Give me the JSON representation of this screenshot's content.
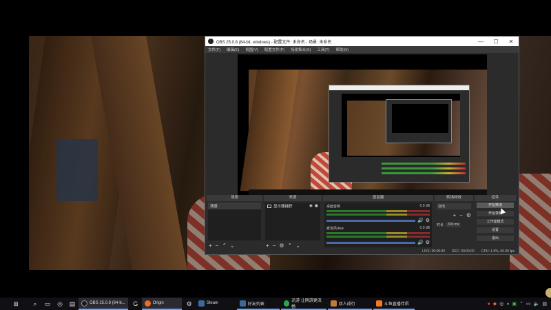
{
  "obs": {
    "title": "OBS 25.0.8 (64-bit, windows) - 配置文件: 未命名 - 场景: 未命名",
    "menu": [
      "文件(F)",
      "编辑(E)",
      "视图(V)",
      "配置文件(P)",
      "场景集合(S)",
      "工具(T)",
      "帮助(H)"
    ],
    "window_controls": [
      "—",
      "☐",
      "✕"
    ],
    "docks": {
      "scenes": {
        "header": "场景",
        "items": [
          "场景"
        ]
      },
      "sources": {
        "header": "来源",
        "items": [
          "显示器捕获"
        ]
      },
      "mixer": {
        "header": "混音器",
        "channels": [
          {
            "name": "桌面音频",
            "level": "0.0 dB"
          },
          {
            "name": "麦克风/Aux",
            "level": "0.0 dB"
          }
        ]
      },
      "transitions": {
        "header": "转场特效",
        "selected": "淡出",
        "duration_label": "时长",
        "duration_value": "300 ms"
      },
      "controls": {
        "header": "控件",
        "buttons": [
          "开始推流",
          "开始录制",
          "工作室模式",
          "设置",
          "退出"
        ]
      }
    },
    "statusbar": {
      "live": "LIVE: 00:00:00",
      "rec": "REC: 00:00:00",
      "cpu": "CPU: 1.8%, 60.00 fps"
    }
  },
  "taskbar": {
    "apps": [
      {
        "label": "OBS 25.0.8 (64-b...",
        "color": "#1a1a1a"
      },
      {
        "label": "Origin",
        "color": "#f26a1b"
      },
      {
        "label": "Steam",
        "color": "#1b2838"
      },
      {
        "label": "好友列表",
        "color": "#1b2838"
      },
      {
        "label": "迅游 让网游更流畅",
        "color": "#2aa84a"
      },
      {
        "label": "双人成行",
        "color": "#c07a3a"
      },
      {
        "label": "斗鱼直播伴侣",
        "color": "#f47a20"
      }
    ]
  },
  "colors": {
    "accent": "#7aa0e0",
    "obs_bg": "#2b2b2b"
  }
}
